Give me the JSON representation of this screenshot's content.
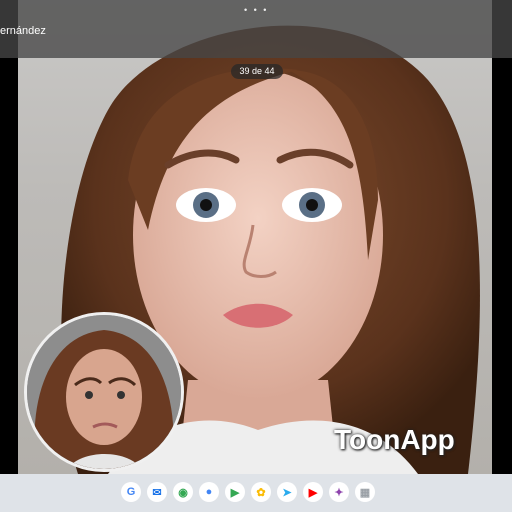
{
  "viewer": {
    "owner_name": "ernández",
    "counter": "39 de 44",
    "watermark": "ToonApp"
  },
  "dock": {
    "apps": [
      {
        "icon": "google-icon",
        "glyph": "G",
        "color": "#4285F4"
      },
      {
        "icon": "messages-icon",
        "glyph": "✉",
        "color": "#1a73e8"
      },
      {
        "icon": "chrome-icon",
        "glyph": "◉",
        "color": "#34A853"
      },
      {
        "icon": "assistant-icon",
        "glyph": "●",
        "color": "#4285F4"
      },
      {
        "icon": "play-store-icon",
        "glyph": "▶",
        "color": "#34A853"
      },
      {
        "icon": "photos-icon",
        "glyph": "✿",
        "color": "#FBBC05"
      },
      {
        "icon": "telegram-icon",
        "glyph": "➤",
        "color": "#2AABEE"
      },
      {
        "icon": "youtube-icon",
        "glyph": "▶",
        "color": "#FF0000"
      },
      {
        "icon": "gemini-icon",
        "glyph": "✦",
        "color": "#8e44ad"
      },
      {
        "icon": "app-drawer-icon",
        "glyph": "▦",
        "color": "#9aa0a6"
      }
    ]
  }
}
